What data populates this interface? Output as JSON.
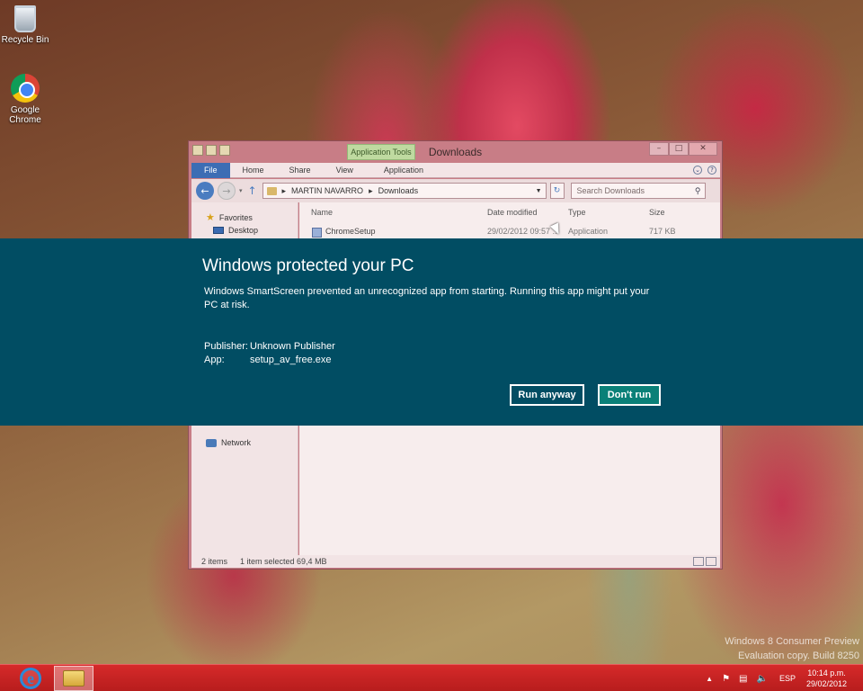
{
  "desktop": {
    "icons": [
      {
        "label": "Recycle Bin"
      },
      {
        "label": "Google\nChrome"
      }
    ]
  },
  "explorer": {
    "title": "Downloads",
    "context_tab": "Application Tools",
    "ribbon_tabs": [
      "File",
      "Home",
      "Share",
      "View",
      "Application"
    ],
    "address": {
      "root": "MARTIN NAVARRO",
      "separator": "▸",
      "folder": "Downloads"
    },
    "search_placeholder": "Search Downloads",
    "nav": {
      "favorites": "Favorites",
      "desktop": "Desktop",
      "network": "Network"
    },
    "columns": [
      "Name",
      "Date modified",
      "Type",
      "Size"
    ],
    "files": [
      {
        "name": "ChromeSetup",
        "date": "29/02/2012 09:57 ...",
        "type": "Application",
        "size": "717 KB"
      }
    ],
    "status": {
      "items": "2 items",
      "selected": "1 item selected  69,4 MB"
    }
  },
  "smartscreen": {
    "title": "Windows protected your PC",
    "message": "Windows SmartScreen prevented an unrecognized app from starting. Running this app might put your PC at risk.",
    "publisher_label": "Publisher:",
    "publisher_value": "Unknown Publisher",
    "app_label": "App:",
    "app_value": "setup_av_free.exe",
    "run_anyway": "Run anyway",
    "dont_run": "Don't run"
  },
  "watermark": {
    "line1": "Windows 8 Consumer Preview",
    "line2": "Evaluation copy. Build 8250"
  },
  "taskbar": {
    "language": "ESP",
    "time": "10:14 p.m.",
    "date": "29/02/2012"
  },
  "colors": {
    "banner": "#014d63",
    "dont_run_button": "#0a8078",
    "taskbar": "#c42323"
  }
}
